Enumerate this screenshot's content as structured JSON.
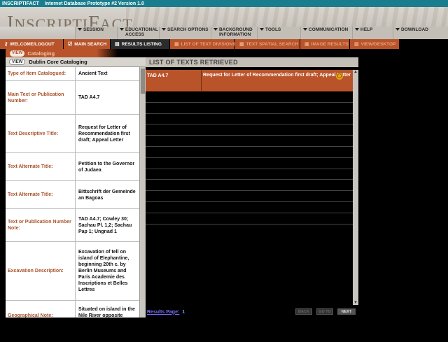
{
  "titlebar": {
    "app": "INSCRIPTIFACT",
    "version": "Internet Database Prototype #2 Version 1.0"
  },
  "logo": {
    "first": "I",
    "rest": "NSCRIPTI",
    "f": "F",
    "rest2": "ACT"
  },
  "nav": [
    {
      "label": "SESSION"
    },
    {
      "label": "EDUCATIONAL ACCESS"
    },
    {
      "label": "SEARCH OPTIONS"
    },
    {
      "label": "BACKGROUND INFORMATION"
    },
    {
      "label": "TOOLS"
    },
    {
      "label": "COMMUNICATION"
    },
    {
      "label": "HELP"
    },
    {
      "label": "DOWNLOAD"
    }
  ],
  "subnav": {
    "welcome": "WELCOME/LOGOUT",
    "main_search": "MAIN SEARCH",
    "results_listing": "RESULTS LISTING",
    "list_divisions": "LIST OF TEXT DIVISIONS",
    "spatial_search": "TEXT SPATIAL SEARCH",
    "image_results": "IMAGE RESULTS",
    "view_desktop": "VIEW/DESKTOP"
  },
  "cataloging": {
    "view_badge": "VIEW",
    "label": "Cataloging"
  },
  "dublin": {
    "view_badge": "VIEW",
    "title": "Dublin Core Cataloging"
  },
  "fields": [
    {
      "key": "Type of Item Catalogued:",
      "value": "Ancient Text"
    },
    {
      "key": "Main Text or Publication Number:",
      "value": "TAD A4.7"
    },
    {
      "key": "Text Descriptive Title:",
      "value": "Request for Letter of Recommendation first draft; Appeal Letter"
    },
    {
      "key": "Text Alternate Title:",
      "value": "Petition to the Governor of Judaea"
    },
    {
      "key": "Text Alternate Title:",
      "value": "Bittschrift der Gemeinde an Bagoas"
    },
    {
      "key": "Text or Publication Number Note:",
      "value": "TAD A4.7; Cowley 30; Sachau Pl. 1,2; Sachau Pap 1; Ungnad 1"
    },
    {
      "key": "Excavation Description:",
      "value": "Excavation of tell on island of Elephantine, beginning 20th c. by Berlin Museums and Paris Academie des Inscriptions et Belles Lettres"
    },
    {
      "key": "Geographical Note:",
      "value": "Situated on island in the Nile River opposite modern Aswan"
    }
  ],
  "results": {
    "header": "LIST OF TEXTS RETRIEVED",
    "row": {
      "id": "TAD A4.7",
      "title": "Request for Letter of Recommendation first draft; Appeal Letter",
      "icon": "glasses-icon"
    },
    "footer": {
      "label": "Results Page:",
      "page": "1",
      "back": "BACK",
      "goto": "GO TO",
      "next": "NEXT"
    }
  },
  "colors": {
    "accent": "#b8532a",
    "header_bg": "#c3beb6",
    "link": "#7b6fff"
  }
}
